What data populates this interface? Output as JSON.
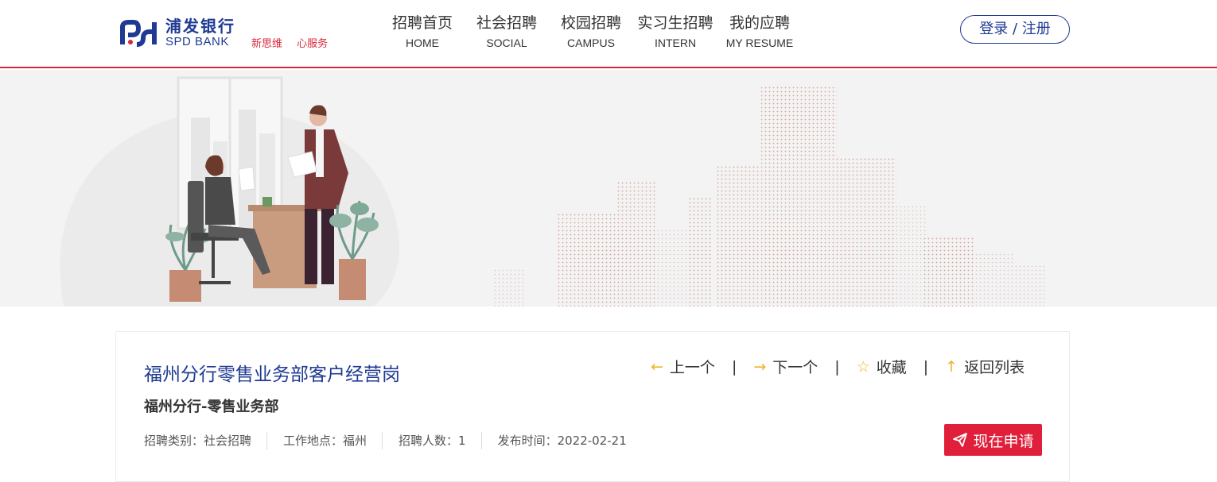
{
  "brand": {
    "name_cn": "浦发银行",
    "name_en": "SPD BANK",
    "slogan": [
      "新思维",
      "心服务"
    ],
    "primary_color": "#1f3a93",
    "accent_color": "#d9263c"
  },
  "nav": [
    {
      "cn": "招聘首页",
      "en": "HOME"
    },
    {
      "cn": "社会招聘",
      "en": "SOCIAL"
    },
    {
      "cn": "校园招聘",
      "en": "CAMPUS"
    },
    {
      "cn": "实习生招聘",
      "en": "INTERN"
    },
    {
      "cn": "我的应聘",
      "en": "MY RESUME"
    }
  ],
  "login_label": "登录 / 注册",
  "job": {
    "title": "福州分行零售业务部客户经营岗",
    "department": "福州分行-零售业务部",
    "meta": [
      "招聘类别：社会招聘",
      "工作地点：福州",
      "招聘人数：1",
      "发布时间：2022-02-21"
    ]
  },
  "actions": {
    "prev": "上一个",
    "next": "下一个",
    "favorite": "收藏",
    "back": "返回列表",
    "separator": "|"
  },
  "apply_label": "现在申请"
}
